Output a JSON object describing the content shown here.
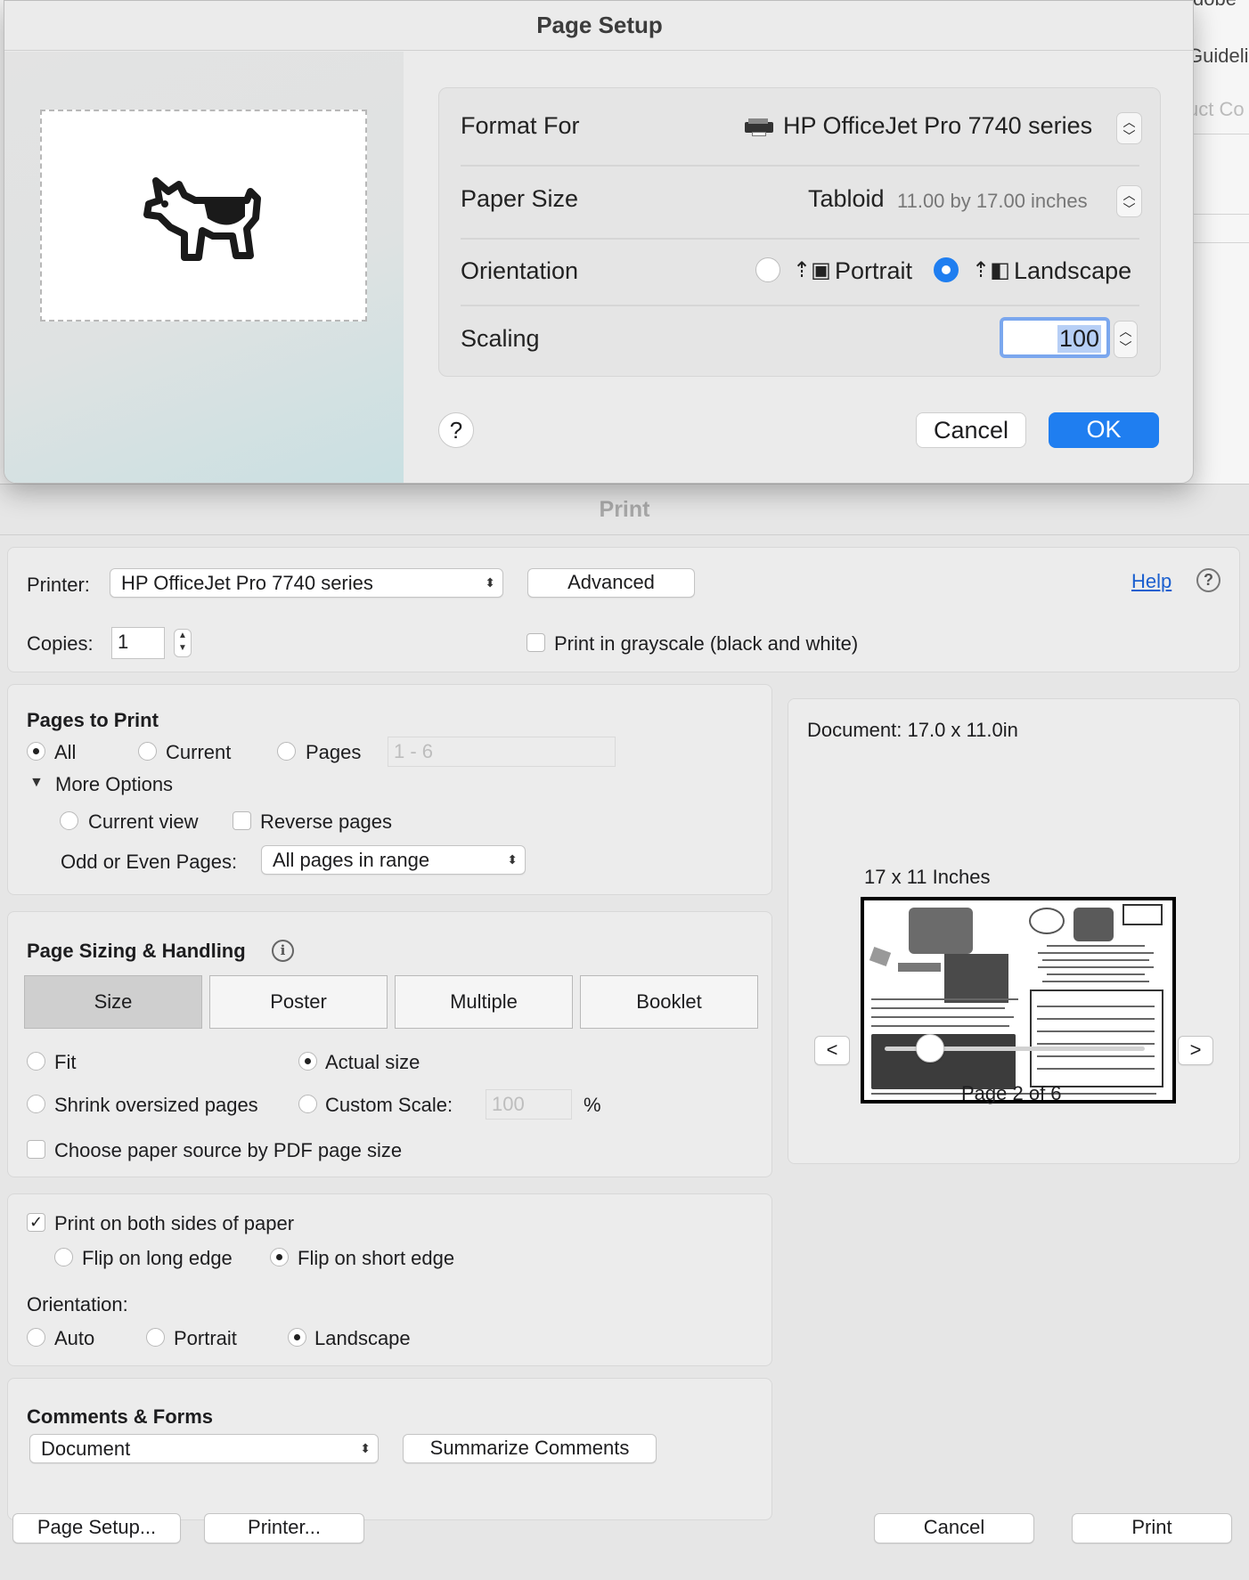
{
  "background_app": {
    "fragments": [
      "dobe",
      "Guideli",
      "uct Co"
    ]
  },
  "page_setup": {
    "title": "Page Setup",
    "format_for_label": "Format For",
    "format_for_value": "HP OfficeJet Pro 7740 series",
    "paper_size_label": "Paper Size",
    "paper_size_value": "Tabloid",
    "paper_size_detail": "11.00 by 17.00 inches",
    "orientation_label": "Orientation",
    "orientation_portrait": "Portrait",
    "orientation_landscape": "Landscape",
    "orientation_selected": "Landscape",
    "scaling_label": "Scaling",
    "scaling_value": "100",
    "help": "?",
    "cancel": "Cancel",
    "ok": "OK",
    "accent": "#1f7ef0"
  },
  "print": {
    "title": "Print",
    "printer_label": "Printer:",
    "printer_value": "HP OfficeJet Pro 7740 series",
    "advanced": "Advanced",
    "help_link": "Help",
    "help_icon": "?",
    "copies_label": "Copies:",
    "copies_value": "1",
    "grayscale": "Print in grayscale (black and white)",
    "pages_to_print": {
      "title": "Pages to Print",
      "all": "All",
      "current": "Current",
      "pages": "Pages",
      "pages_range": "1 - 6",
      "more_options": "More Options",
      "current_view": "Current view",
      "reverse_pages": "Reverse pages",
      "odd_even_label": "Odd or Even Pages:",
      "odd_even_value": "All pages in range"
    },
    "sizing": {
      "title": "Page Sizing & Handling",
      "info_icon": "i",
      "tabs": [
        "Size",
        "Poster",
        "Multiple",
        "Booklet"
      ],
      "selected_tab": "Size",
      "fit": "Fit",
      "actual_size": "Actual size",
      "shrink": "Shrink oversized pages",
      "custom_scale": "Custom Scale:",
      "custom_scale_value": "100",
      "percent": "%",
      "paper_source": "Choose paper source by PDF page size"
    },
    "duplex": {
      "both_sides": "Print on both sides of paper",
      "long_edge": "Flip on long edge",
      "short_edge": "Flip on short edge",
      "orientation_label": "Orientation:",
      "auto": "Auto",
      "portrait": "Portrait",
      "landscape": "Landscape"
    },
    "comments": {
      "title": "Comments & Forms",
      "value": "Document",
      "summarize": "Summarize Comments"
    },
    "preview": {
      "document": "Document: 17.0 x 11.0in",
      "paper": "17 x 11 Inches",
      "prev": "<",
      "next": ">",
      "page_info": "Page 2 of 6",
      "page_current": 2,
      "page_total": 6
    },
    "page_setup_button": "Page Setup...",
    "printer_button": "Printer...",
    "cancel": "Cancel",
    "print_button": "Print",
    "link_color": "#1a5fcf"
  }
}
